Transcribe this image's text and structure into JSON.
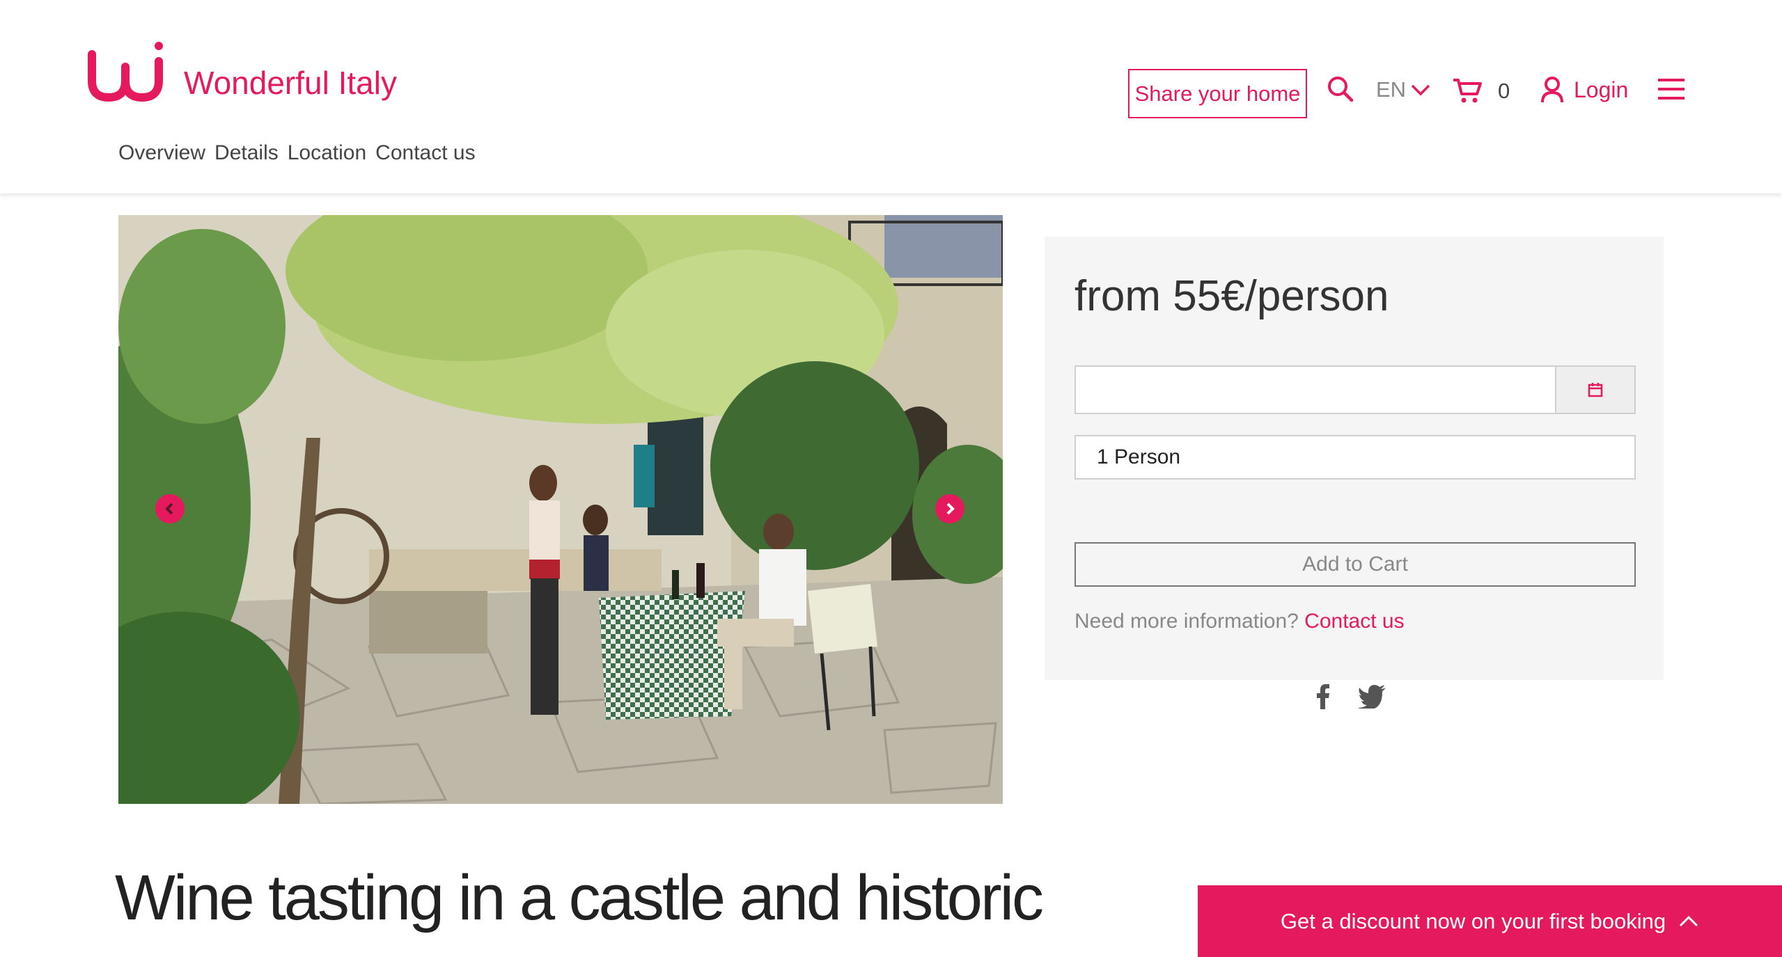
{
  "brand": {
    "name": "Wonderful Italy",
    "accent": "#e5195e"
  },
  "subnav": [
    {
      "label": "Overview"
    },
    {
      "label": "Details"
    },
    {
      "label": "Location"
    },
    {
      "label": "Contact us"
    }
  ],
  "header": {
    "share_label": "Share your home",
    "language": "EN",
    "cart_count": "0",
    "login_label": "Login"
  },
  "gallery": {
    "prev_icon": "chevron-left-icon",
    "next_icon": "chevron-right-icon"
  },
  "booking": {
    "price": "from 55€/person",
    "date_value": "",
    "persons": "1 Person",
    "add_to_cart": "Add to Cart",
    "info_text": "Need more information?",
    "info_link": "Contact us"
  },
  "social": [
    "facebook-icon",
    "twitter-icon"
  ],
  "title": "Wine tasting in a castle and historic",
  "discount": {
    "label": "Get a discount now on your first booking"
  }
}
